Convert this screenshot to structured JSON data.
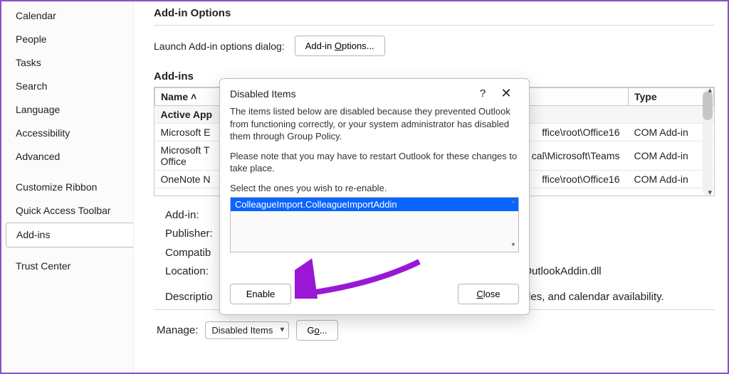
{
  "sidebar": {
    "items": [
      "Calendar",
      "People",
      "Tasks",
      "Search",
      "Language",
      "Accessibility",
      "Advanced",
      "Customize Ribbon",
      "Quick Access Toolbar",
      "Add-ins",
      "Trust Center"
    ],
    "selected": "Add-ins"
  },
  "main": {
    "heading": "Add-in Options",
    "launch_label": "Launch Add-in options dialog:",
    "launch_button_pre": "Add-in ",
    "launch_button_u": "O",
    "launch_button_post": "ptions...",
    "addins_heading": "Add-ins",
    "table": {
      "headers": [
        "Name ˄",
        "",
        "Type"
      ],
      "section_label": "Active App",
      "rows": [
        {
          "name": "Microsoft E",
          "path": "ffice\\root\\Office16",
          "type": "COM Add-in"
        },
        {
          "name": "Microsoft T\nOffice",
          "path": "cal\\Microsoft\\Teams",
          "type": "COM Add-in"
        },
        {
          "name": "OneNote N",
          "path": "ffice\\root\\Office16",
          "type": "COM Add-in"
        }
      ]
    },
    "details": {
      "addin_label": "Add-in:",
      "publisher_label": "Publisher:",
      "compat_label": "Compatib",
      "location_label": "Location:",
      "location_tail": "mOutlookAddin.dll",
      "description_pre": "Descriptio",
      "description_tail": "rules, and calendar availability."
    },
    "manage_label": "Manage:",
    "manage_value": "Disabled Items",
    "go_pre": "G",
    "go_u": "o",
    "go_post": "..."
  },
  "dialog": {
    "title": "Disabled Items",
    "help": "?",
    "close_x": "✕",
    "p1": "The items listed below are disabled because they prevented Outlook from functioning correctly, or your system administrator has disabled them through Group Policy.",
    "p2": "Please note that you may have to restart Outlook for these changes to take place.",
    "p3": "Select the ones you wish to re-enable.",
    "list": [
      {
        "label": "ColleagueImport.ColleagueImportAddin",
        "selected": true
      }
    ],
    "enable_label": "Enable",
    "close_label_u": "C",
    "close_label_post": "lose"
  }
}
